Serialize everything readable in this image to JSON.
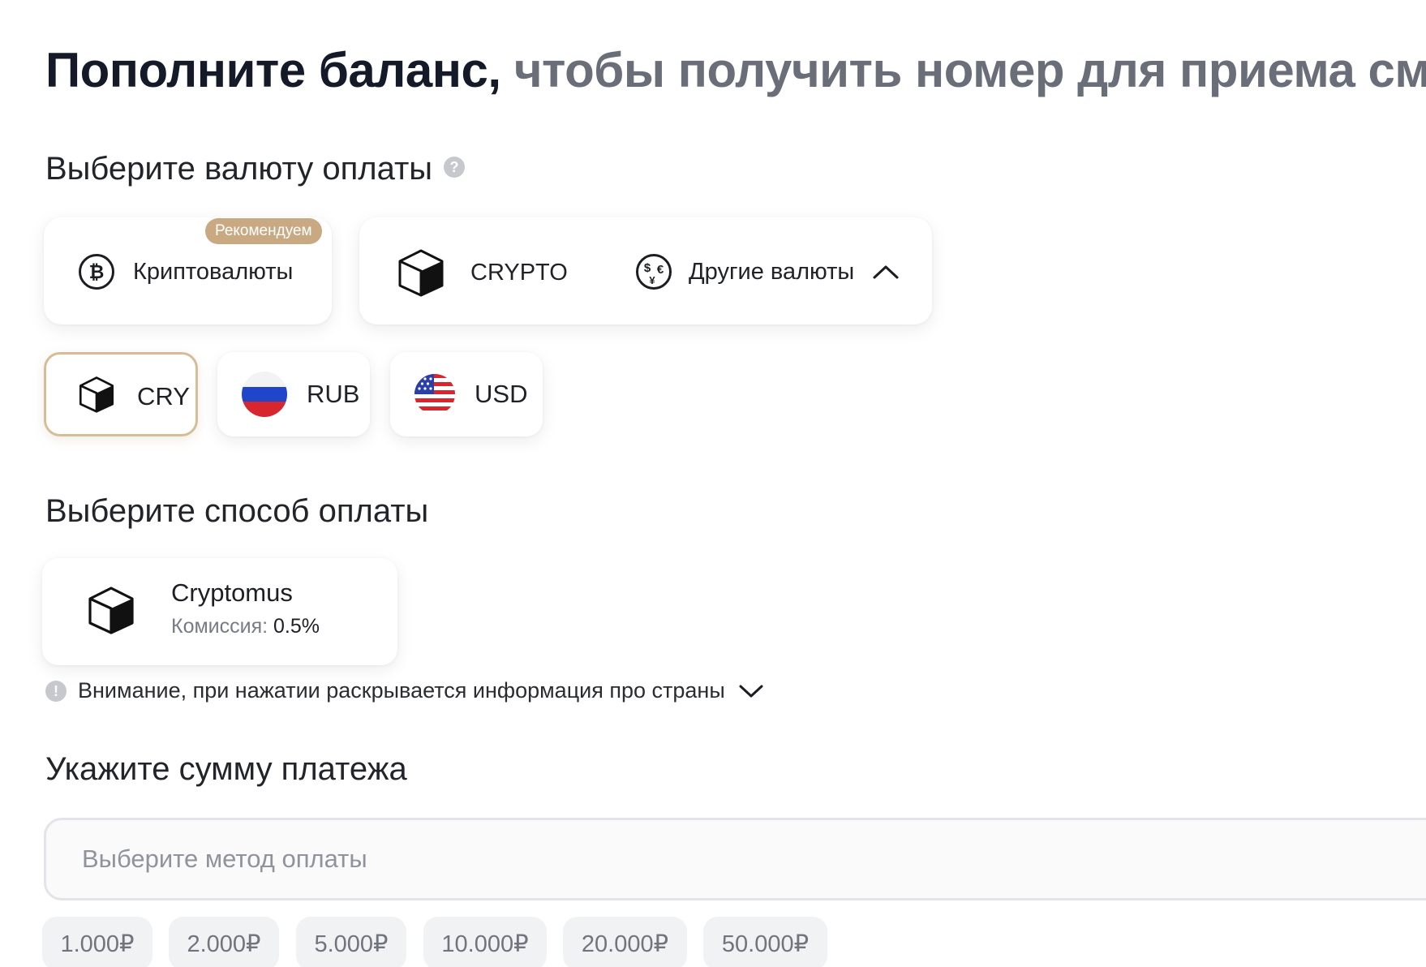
{
  "title": {
    "bold": "Пополните баланс,",
    "muted": "чтобы получить номер для приема смс"
  },
  "currency_section": {
    "title": "Выберите валюту оплаты",
    "help_glyph": "?"
  },
  "currency_types": {
    "badge": "Рекомендуем",
    "crypto_label": "Криптовалюты",
    "crypto_brand_label": "CRYPTO",
    "other_label": "Другие валюты"
  },
  "currencies": [
    {
      "code": "CRY",
      "selected": true
    },
    {
      "code": "RUB",
      "selected": false
    },
    {
      "code": "USD",
      "selected": false
    }
  ],
  "method_section": {
    "title": "Выберите способ оплаты"
  },
  "method": {
    "name": "Cryptomus",
    "fee_label": "Комиссия:",
    "fee_value": "0.5%"
  },
  "notice": {
    "glyph": "!",
    "text": "Внимание, при нажатии раскрывается информация про страны"
  },
  "amount_section": {
    "title": "Укажите сумму платежа",
    "placeholder": "Выберите метод оплаты"
  },
  "presets": [
    "1.000₽",
    "2.000₽",
    "5.000₽",
    "10.000₽",
    "20.000₽",
    "50.000₽"
  ],
  "colors": {
    "accent_gold": "#c9a982",
    "selected_border": "#d7bd97",
    "title_dark": "#141a28",
    "title_muted": "#6a6e79"
  }
}
